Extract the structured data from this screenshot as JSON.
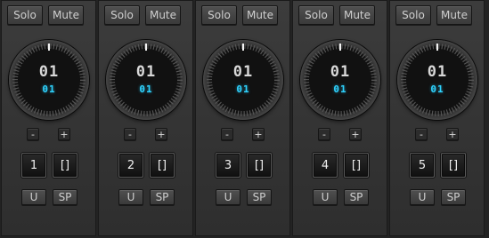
{
  "strips": [
    {
      "solo": "Solo",
      "mute": "Mute",
      "dial_main": "01",
      "dial_sub": "01",
      "minus": "-",
      "plus": "+",
      "number": "1",
      "bracket": "[]",
      "u": "U",
      "sp": "SP"
    },
    {
      "solo": "Solo",
      "mute": "Mute",
      "dial_main": "01",
      "dial_sub": "01",
      "minus": "-",
      "plus": "+",
      "number": "2",
      "bracket": "[]",
      "u": "U",
      "sp": "SP"
    },
    {
      "solo": "Solo",
      "mute": "Mute",
      "dial_main": "01",
      "dial_sub": "01",
      "minus": "-",
      "plus": "+",
      "number": "3",
      "bracket": "[]",
      "u": "U",
      "sp": "SP"
    },
    {
      "solo": "Solo",
      "mute": "Mute",
      "dial_main": "01",
      "dial_sub": "01",
      "minus": "-",
      "plus": "+",
      "number": "4",
      "bracket": "[]",
      "u": "U",
      "sp": "SP"
    },
    {
      "solo": "Solo",
      "mute": "Mute",
      "dial_main": "01",
      "dial_sub": "01",
      "minus": "-",
      "plus": "+",
      "number": "5",
      "bracket": "[]",
      "u": "U",
      "sp": "SP"
    }
  ],
  "colors": {
    "display_accent": "#2ed3ff",
    "panel": "#333333"
  }
}
